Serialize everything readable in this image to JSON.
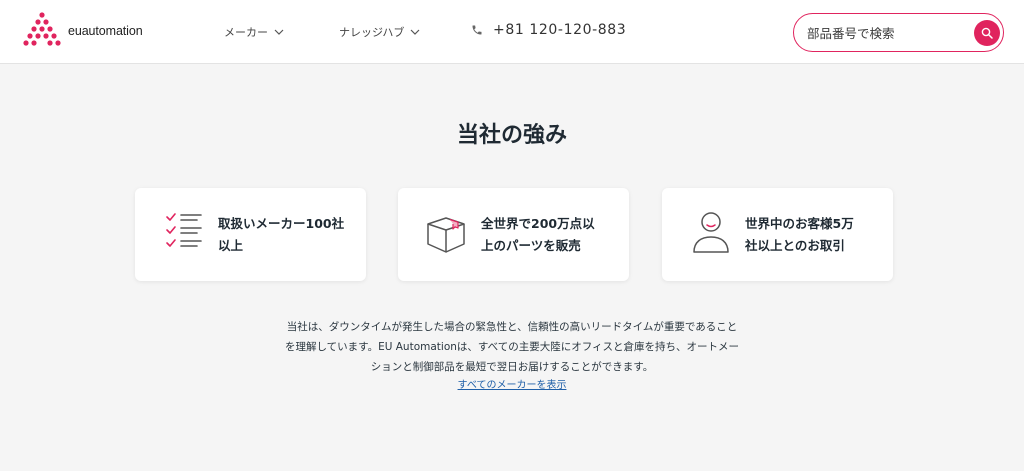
{
  "header": {
    "logo_text": "euautomation",
    "nav": [
      {
        "label": "メーカー"
      },
      {
        "label": "ナレッジハブ"
      }
    ],
    "phone": "+81 120-120-883",
    "search": {
      "placeholder": "部品番号で検索"
    }
  },
  "main": {
    "title": "当社の強み",
    "cards": [
      {
        "line1": "取扱いメーカー100社",
        "line2": "以上",
        "icon": "checklist-icon"
      },
      {
        "line1": "全世界で200万点以",
        "line2": "上のパーツを販売",
        "icon": "box-icon"
      },
      {
        "line1": "世界中のお客様5万",
        "line2": "社以上とのお取引",
        "icon": "customer-icon"
      }
    ],
    "description": [
      "当社は、ダウンタイムが発生した場合の緊急性と、信頼性の高いリードタイムが重要であること",
      "を理解しています。EU Automationは、すべての主要大陸にオフィスと倉庫を持ち、オートメー",
      "ションと制御部品を最短で翌日お届けすることができます。"
    ],
    "link": "すべてのメーカーを表示"
  },
  "colors": {
    "accent": "#e0245e",
    "link": "#1f5fa8",
    "text": "#1f2a33"
  }
}
